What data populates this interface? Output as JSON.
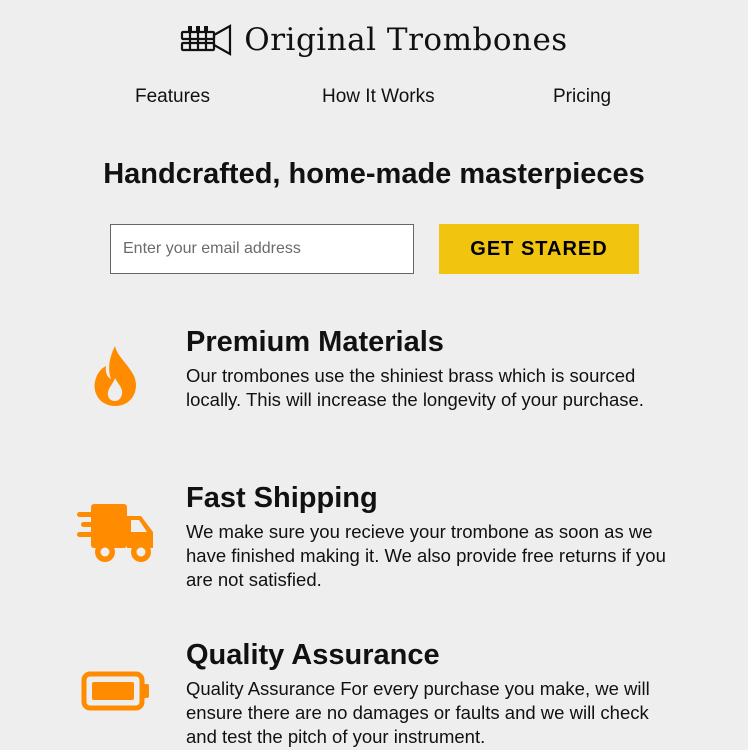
{
  "header": {
    "brand": "Original Trombones",
    "logo_icon": "trombone-icon"
  },
  "nav": {
    "items": [
      {
        "label": "Features"
      },
      {
        "label": "How It Works"
      },
      {
        "label": "Pricing"
      }
    ]
  },
  "hero": {
    "title": "Handcrafted, home-made masterpieces",
    "email_placeholder": "Enter your email address",
    "cta_label": "GET STARED"
  },
  "features": [
    {
      "icon": "fire-icon",
      "title": "Premium Materials",
      "text": "Our trombones use the shiniest brass which is sourced locally. This will increase the longevity of your purchase."
    },
    {
      "icon": "truck-icon",
      "title": "Fast Shipping",
      "text": "We make sure you recieve your trombone as soon as we have finished making it. We also provide free returns if you are not satisfied."
    },
    {
      "icon": "battery-icon",
      "title": "Quality Assurance",
      "text": "Quality Assurance For every purchase you make, we will ensure there are no damages or faults and we will check and test the pitch of your instrument."
    }
  ],
  "colors": {
    "accent": "#f1c40f",
    "icon": "#ff8c00",
    "background": "#eeeeee"
  }
}
